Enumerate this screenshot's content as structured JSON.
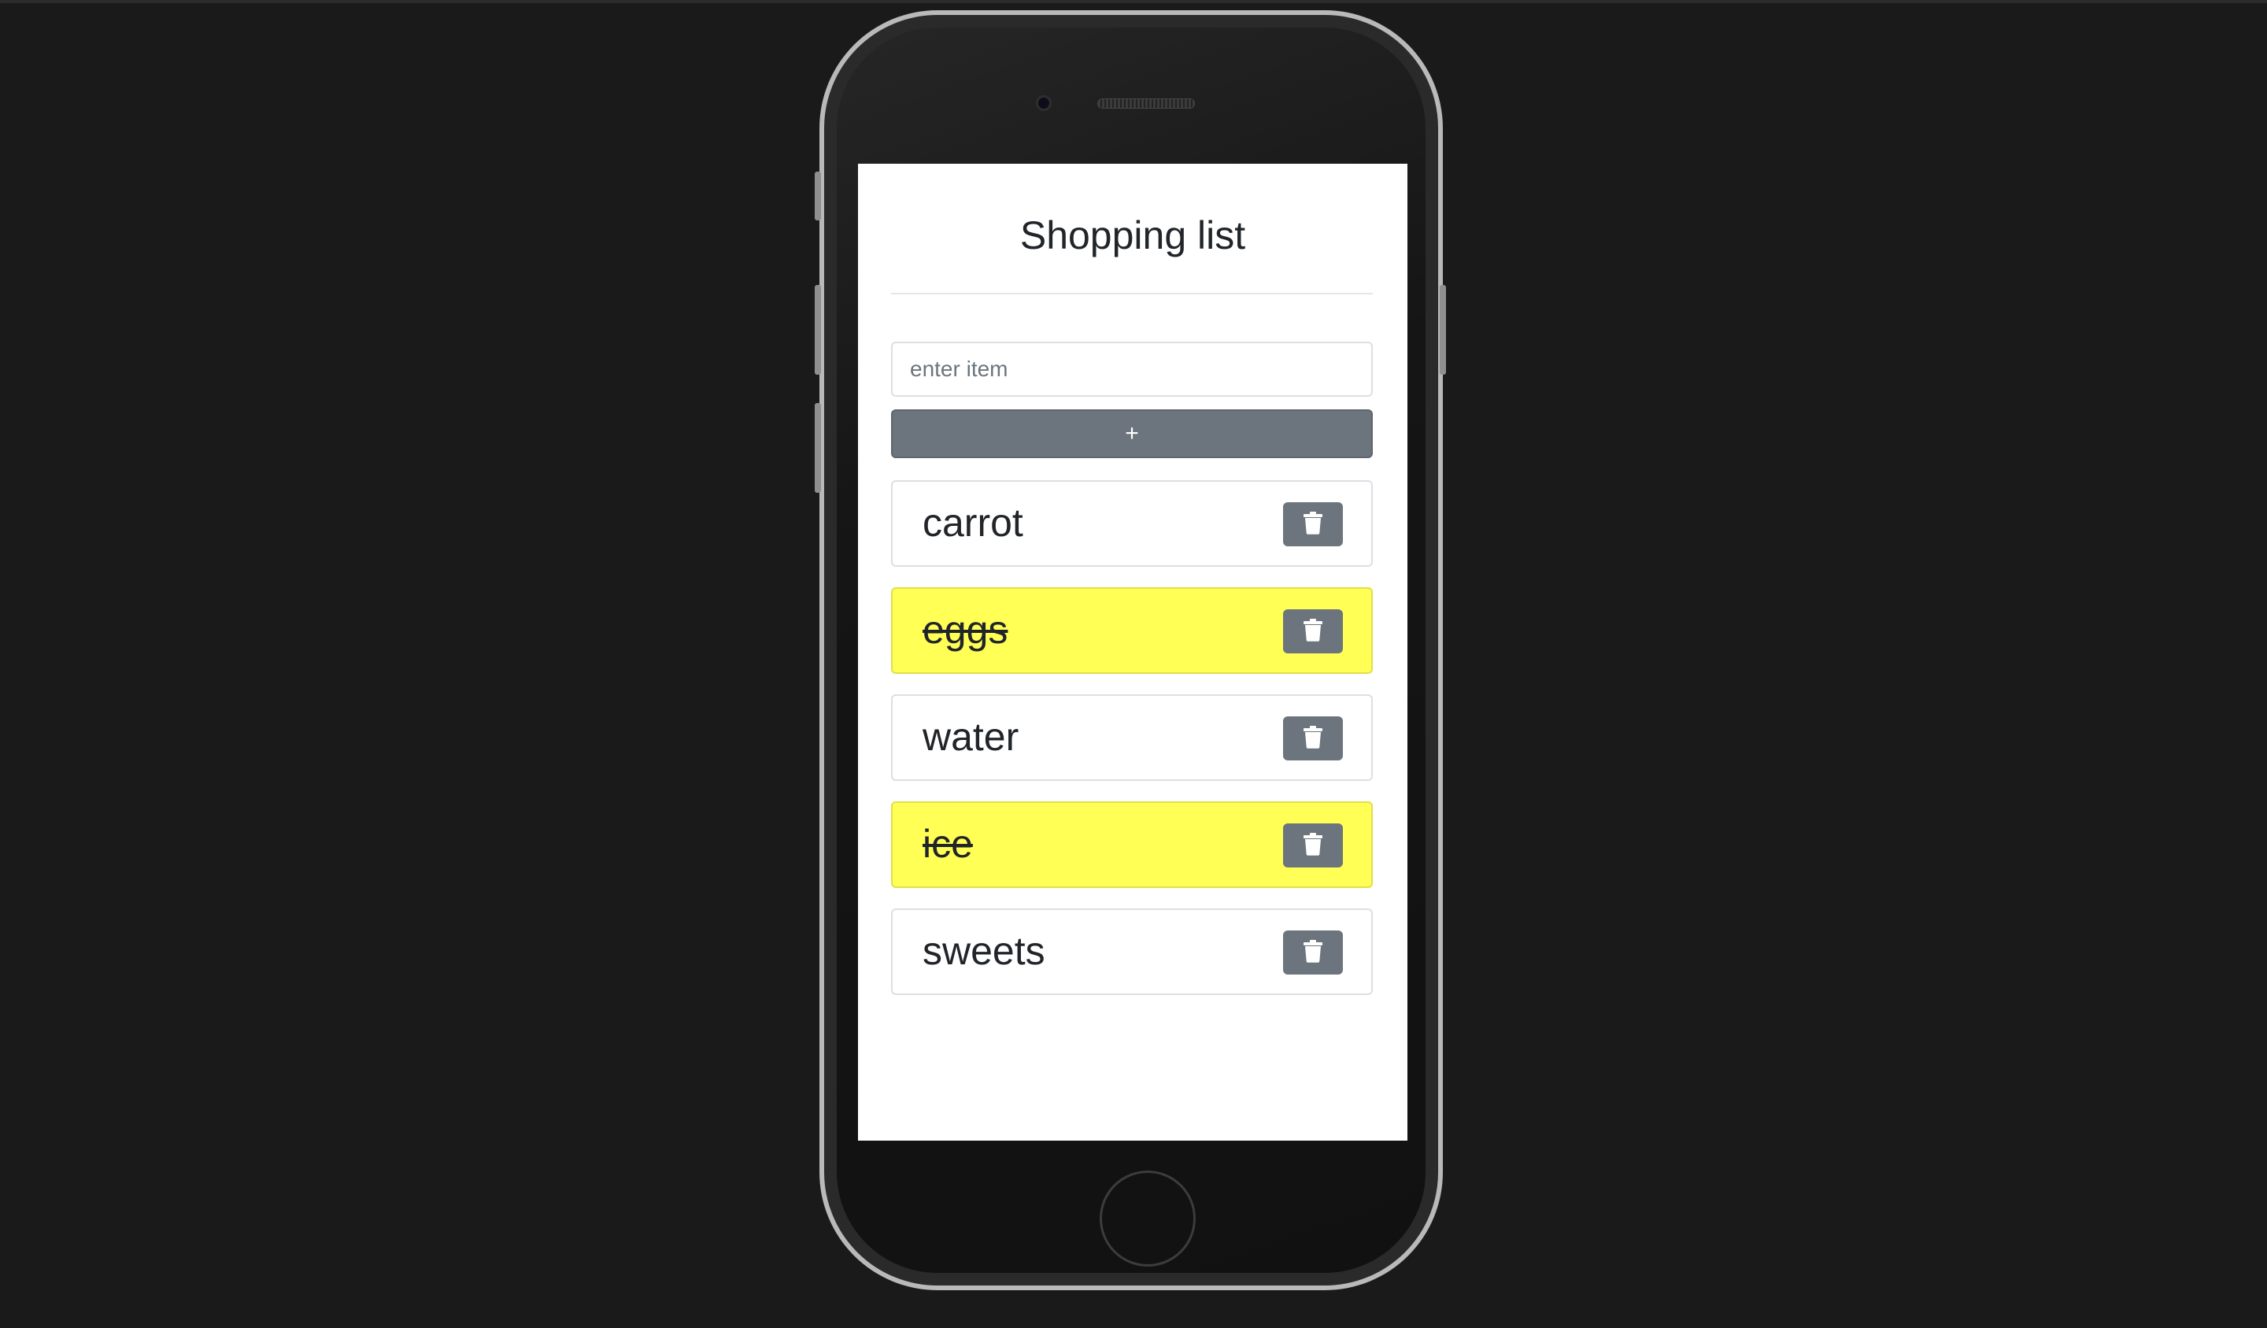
{
  "app": {
    "title": "Shopping list"
  },
  "form": {
    "input_placeholder": "enter item",
    "input_value": "",
    "add_button_label": "+"
  },
  "items": [
    {
      "label": "carrot",
      "done": false
    },
    {
      "label": "eggs",
      "done": true
    },
    {
      "label": "water",
      "done": false
    },
    {
      "label": "ice",
      "done": true
    },
    {
      "label": "sweets",
      "done": false
    }
  ],
  "icons": {
    "delete": "trash-icon"
  },
  "colors": {
    "page_background": "#1a1a1a",
    "screen_background": "#ffffff",
    "done_highlight": "#ffff55",
    "button_gray": "#6c757d",
    "text": "#212529"
  }
}
